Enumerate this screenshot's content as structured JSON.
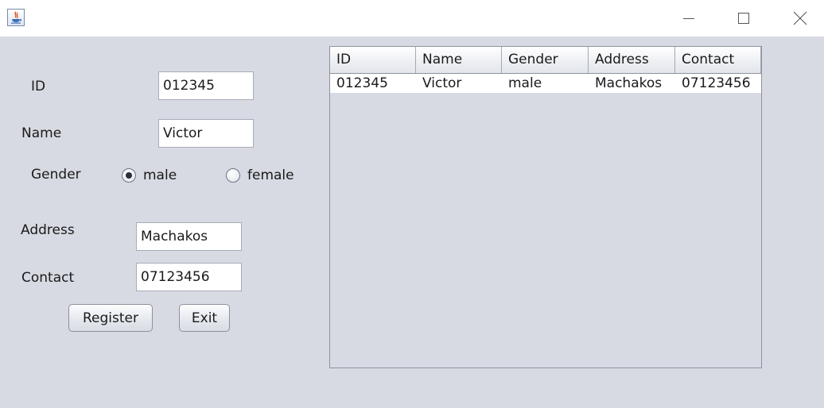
{
  "form": {
    "id_label": "ID",
    "id_value": "012345",
    "name_label": "Name",
    "name_value": "Victor",
    "gender_label": "Gender",
    "gender_options": [
      {
        "label": "male",
        "checked": true
      },
      {
        "label": "female",
        "checked": false
      }
    ],
    "address_label": "Address",
    "address_value": "Machakos",
    "contact_label": "Contact",
    "contact_value": "07123456",
    "register_label": "Register",
    "exit_label": "Exit"
  },
  "table": {
    "columns": [
      "ID",
      "Name",
      "Gender",
      "Address",
      "Contact"
    ],
    "rows": [
      [
        "012345",
        "Victor",
        "male",
        "Machakos",
        "07123456"
      ]
    ]
  },
  "icons": {
    "app": "java-icon",
    "minimize": "minimize-icon",
    "maximize": "maximize-icon",
    "close": "close-icon"
  },
  "colors": {
    "window_bg": "#d7dae2",
    "titlebar_bg": "#ffffff",
    "row_bg": "#ffffff"
  }
}
